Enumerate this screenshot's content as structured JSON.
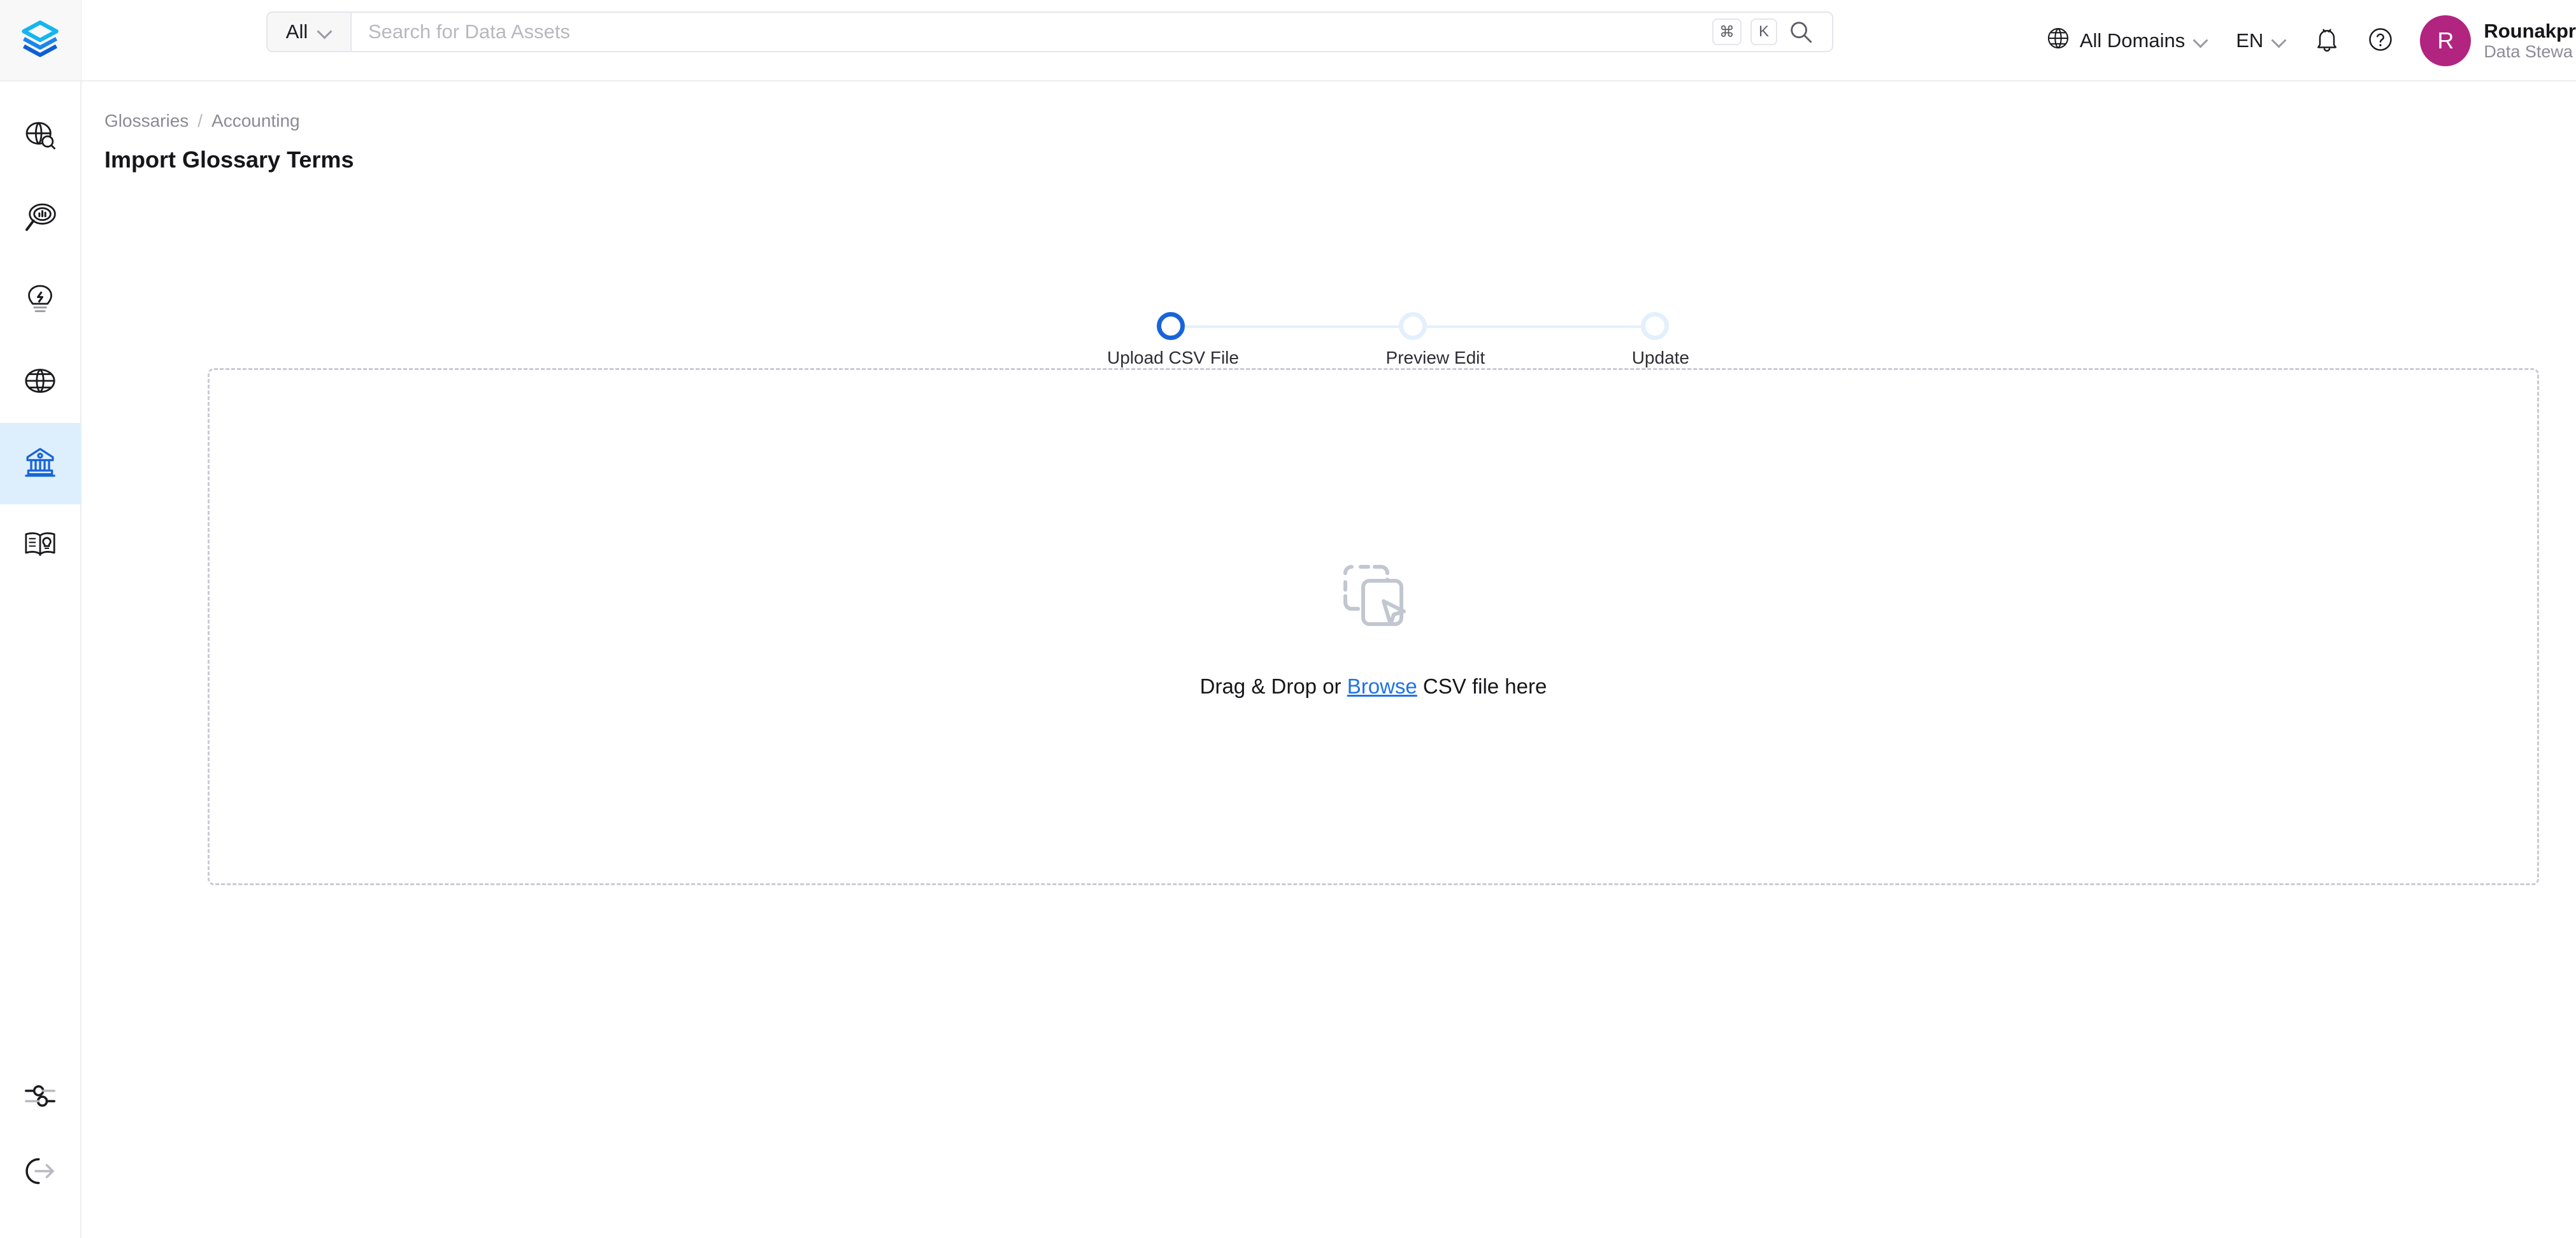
{
  "app": {
    "logo_name": "openmetadata-layers-logo"
  },
  "sidebar": {
    "top_items": [
      {
        "name": "explore",
        "icon": "globe-search-icon"
      },
      {
        "name": "observability",
        "icon": "magnifier-chart-icon"
      },
      {
        "name": "insights",
        "icon": "lightbulb-icon"
      },
      {
        "name": "domains",
        "icon": "globe-icon"
      },
      {
        "name": "govern",
        "icon": "bank-icon",
        "active": true
      },
      {
        "name": "glossary",
        "icon": "open-book-icon"
      }
    ],
    "bottom_items": [
      {
        "name": "settings",
        "icon": "sliders-icon"
      },
      {
        "name": "logout",
        "icon": "logout-arrow-icon"
      }
    ]
  },
  "header": {
    "search": {
      "scope_label": "All",
      "scope_caret_icon": "chevron-down-icon",
      "placeholder": "Search for Data Assets",
      "value": "",
      "shortcut_keys": [
        "⌘",
        "K"
      ],
      "search_icon": "search-icon"
    },
    "domain_selector": {
      "label": "All Domains",
      "icon": "globe-icon",
      "caret_icon": "chevron-down-icon"
    },
    "language_selector": {
      "label": "EN",
      "caret_icon": "chevron-down-icon"
    },
    "notifications": {
      "icon": "bell-icon"
    },
    "help": {
      "icon": "question-circle-icon"
    },
    "user": {
      "initial": "R",
      "name": "Rounakpr",
      "role": "Data Stewa",
      "avatar_color": "#b1247f"
    }
  },
  "main": {
    "breadcrumb": {
      "items": [
        "Glossaries",
        "Accounting"
      ],
      "separator": "/"
    },
    "page_title": "Import Glossary Terms",
    "stepper": {
      "steps": [
        {
          "label": "Upload CSV File",
          "active": true
        },
        {
          "label": "Preview Edit",
          "active": false
        },
        {
          "label": "Update",
          "active": false
        }
      ],
      "active_color": "#1964d8",
      "inactive_color": "#e3f0fc"
    },
    "dropzone": {
      "icon": "drag-drop-file-icon",
      "text_before": "Drag & Drop or ",
      "link_label": "Browse",
      "text_after": " CSV file here",
      "link_color": "#1e73e8",
      "border_color": "#c9cbd4"
    }
  }
}
